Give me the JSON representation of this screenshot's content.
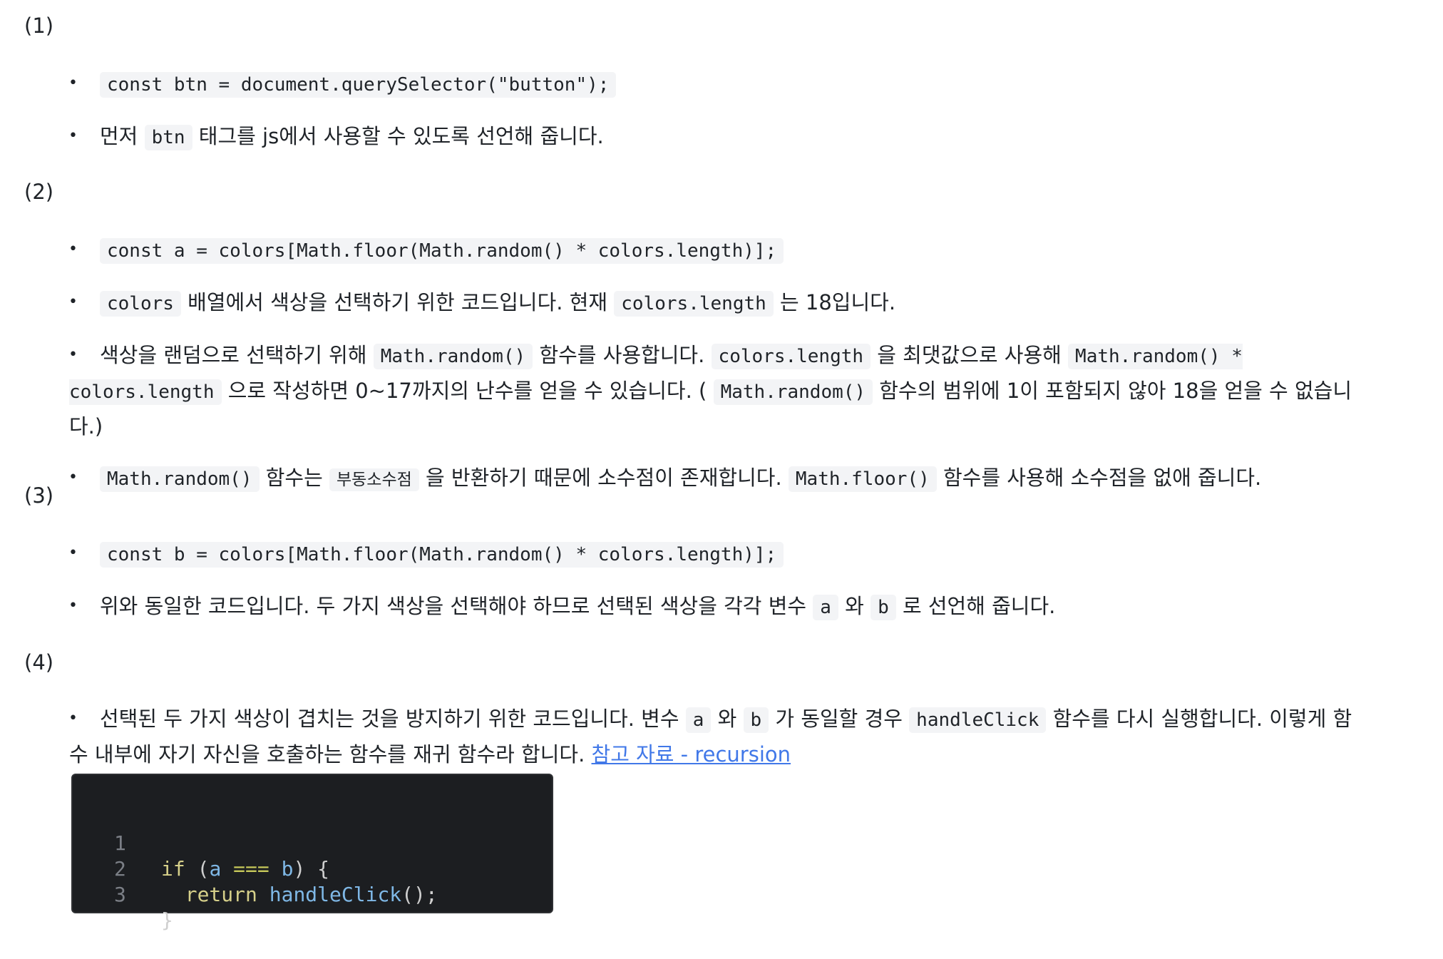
{
  "sections": [
    {
      "heading": "(1)",
      "items": [
        {
          "code": "const btn = document.querySelector(\"button\");"
        },
        {
          "pre": "먼저",
          "code1": "btn",
          "post": "태그를 js에서 사용할 수 있도록 선언해 줍니다."
        }
      ]
    },
    {
      "heading": "(2)",
      "items": [
        {
          "code": "const a = colors[Math.floor(Math.random() * colors.length)];"
        },
        {
          "code1": "colors",
          "mid1": "배열에서 색상을 선택하기 위한 코드입니다. 현재",
          "code2": "colors.length",
          "post": "는 18입니다."
        },
        {
          "pre": "색상을 랜덤으로 선택하기 위해",
          "code1": "Math.random()",
          "mid1": "함수를 사용합니다.",
          "code2": "colors.length",
          "mid2": "을 최댓값으로 사용해",
          "code3": "Math.random() * colors.length",
          "mid3": "으로 작성하면 0~17까지의 난수를 얻을 수 있습니다. (",
          "code4": "Math.random()",
          "post": "함수의 범위에 1이 포함되지 않아 18을 얻을 수 없습니다.)"
        },
        {
          "code1": "Math.random()",
          "mid1": "함수는",
          "code2": "부동소수점",
          "mid2": "을 반환하기 때문에 소수점이 존재합니다.",
          "code3": "Math.floor()",
          "post": "함수를 사용해 소수점을 없애 줍니다."
        }
      ]
    },
    {
      "heading": "(3)",
      "items": [
        {
          "code": "const b = colors[Math.floor(Math.random() * colors.length)];"
        },
        {
          "pre": "위와 동일한 코드입니다. 두 가지 색상을 선택해야 하므로 선택된 색상을 각각 변수",
          "code1": "a",
          "mid1": "와",
          "code2": "b",
          "post": "로 선언해 줍니다."
        }
      ]
    },
    {
      "heading": "(4)",
      "items": [
        {
          "pre": "선택된 두 가지 색상이 겹치는 것을 방지하기 위한 코드입니다. 변수",
          "code1": "a",
          "mid1": "와",
          "code2": "b",
          "mid2": "가 동일할 경우",
          "code3": "handleClick",
          "post": "함수를 다시 실행합니다. 이렇게 함수 내부에 자기 자신을 호출하는 함수를 재귀 함수라 합니다.",
          "link": "참고 자료 - recursion"
        }
      ]
    }
  ],
  "bullet": "•",
  "code_block": {
    "line_numbers": [
      "1",
      "2",
      "3"
    ],
    "line1": {
      "kw": "if",
      "p1": " (",
      "v1": "a",
      "op": " === ",
      "v2": "b",
      "p2": ") {"
    },
    "line2": {
      "indent": "  ",
      "kw": "return",
      "fn": " handleClick",
      "p": "();"
    },
    "line3": {
      "p": "}"
    },
    "colors": {
      "background": "#1c1e21",
      "keyword": "#d6d08a",
      "identifier": "#7fb8e6",
      "line_number": "#7b7f86"
    }
  },
  "colors": {
    "link": "#4178e8",
    "inline_code_bg": "#f3f4f6",
    "text": "#1f2328"
  }
}
